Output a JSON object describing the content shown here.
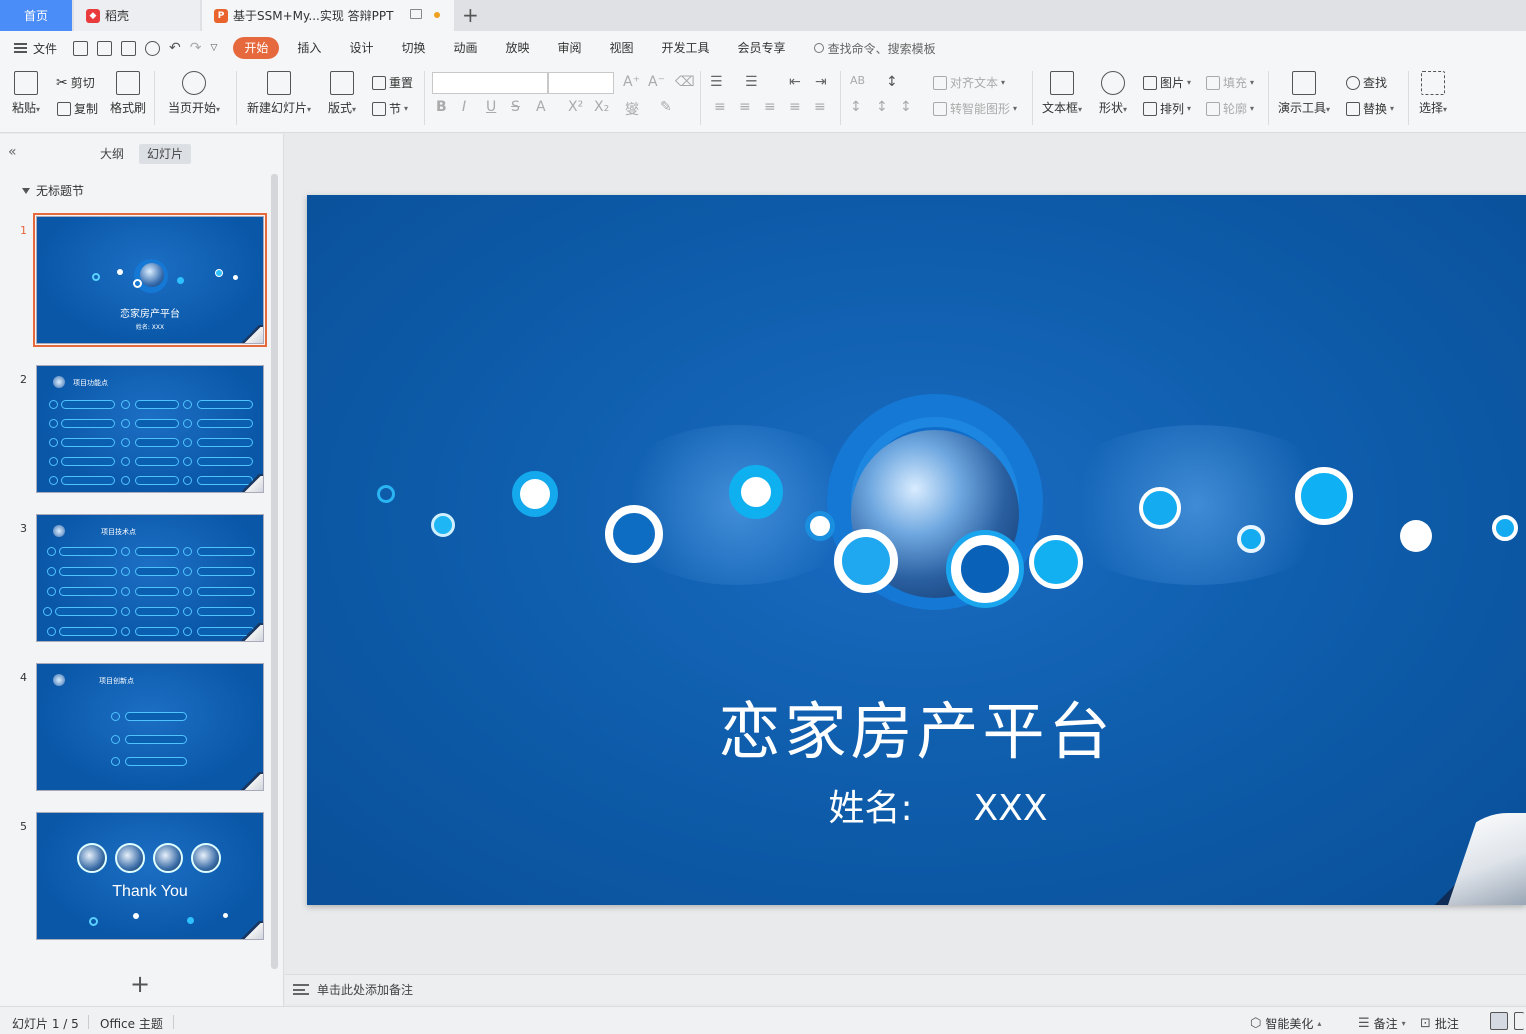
{
  "tabs": {
    "home": "首页",
    "docer": "稻壳",
    "ppt_title": "基于SSM+My...实现 答辩PPT"
  },
  "menu": {
    "file": "文件",
    "items": [
      "开始",
      "插入",
      "设计",
      "切换",
      "动画",
      "放映",
      "审阅",
      "视图",
      "开发工具",
      "会员专享"
    ],
    "search_placeholder": "查找命令、搜索模板"
  },
  "ribbon": {
    "paste": "粘贴",
    "cut": "剪切",
    "copy": "复制",
    "format_painter": "格式刷",
    "from_current": "当页开始",
    "new_slide": "新建幻灯片",
    "layout": "版式",
    "reset": "重置",
    "section": "节",
    "align_text": "对齐文本",
    "to_smartart": "转智能图形",
    "text_box": "文本框",
    "shapes": "形状",
    "picture": "图片",
    "arrange": "排列",
    "fill": "填充",
    "outline": "轮廓",
    "presentation_tools": "演示工具",
    "find": "查找",
    "replace": "替换",
    "select": "选择"
  },
  "left_panel": {
    "tab_outline": "大纲",
    "tab_slides": "幻灯片",
    "section_title": "无标题节",
    "slides": [
      {
        "num": "1",
        "title": "恋家房产平台",
        "subtitle": "姓名:    XXX"
      },
      {
        "num": "2",
        "title": "项目功能点"
      },
      {
        "num": "3",
        "title": "项目技术点"
      },
      {
        "num": "4",
        "title": "项目创新点"
      },
      {
        "num": "5",
        "title": "Thank You"
      }
    ]
  },
  "slide": {
    "title": "恋家房产平台",
    "name_label": "姓名:",
    "name_value": "XXX"
  },
  "notes_placeholder": "单击此处添加备注",
  "status": {
    "slide_counter": "幻灯片 1 / 5",
    "theme": "Office 主题",
    "beautify": "智能美化",
    "notes": "备注",
    "comments": "批注"
  },
  "colors": {
    "accent": "#e6683d",
    "home_tab": "#4b8df8",
    "slide_bg": "#0d5ba9",
    "circle_cyan": "#0fb0f0"
  }
}
